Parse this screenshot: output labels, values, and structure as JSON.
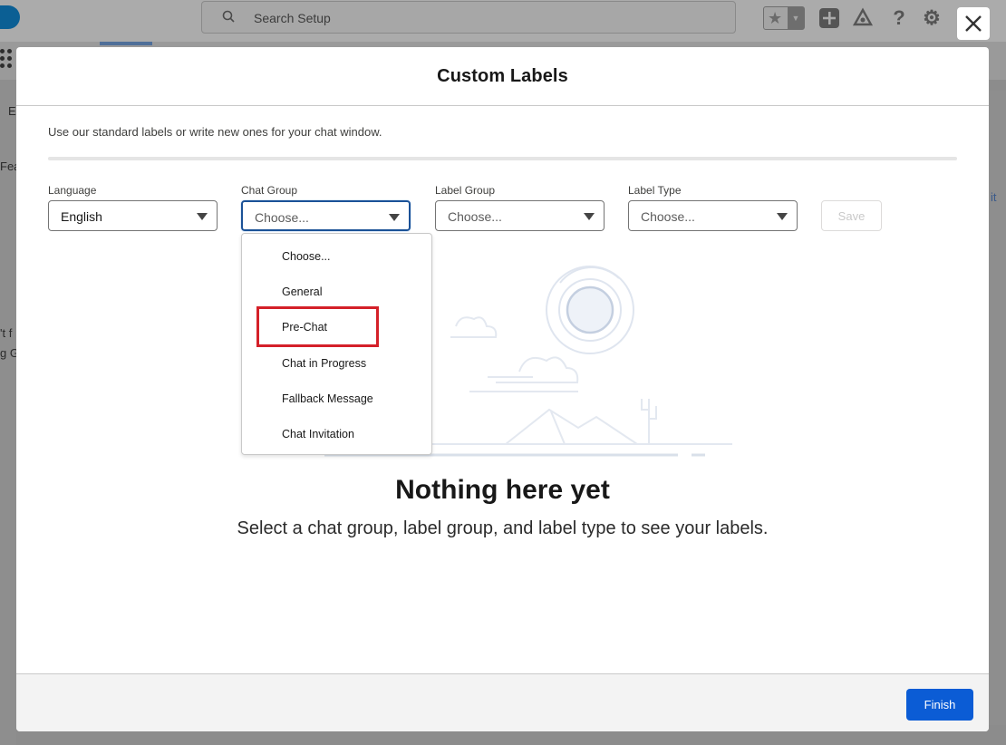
{
  "background": {
    "search_placeholder": "Search Setup",
    "left_texts": [
      "E",
      "Fea",
      "'t f",
      "g G"
    ],
    "right_texts": [
      "it"
    ],
    "icons": [
      "salesforce-cloud-icon",
      "search-icon",
      "star-icon",
      "add-icon",
      "trailhead-icon",
      "help-icon",
      "gear-icon",
      "app-launcher-icon"
    ]
  },
  "modal": {
    "title": "Custom Labels",
    "intro": "Use our standard labels or write new ones for your chat window.",
    "fields": {
      "language": {
        "label": "Language",
        "value": "English"
      },
      "chat_group": {
        "label": "Chat Group",
        "value": "Choose..."
      },
      "label_group": {
        "label": "Label Group",
        "value": "Choose..."
      },
      "label_type": {
        "label": "Label Type",
        "value": "Choose..."
      }
    },
    "save_label": "Save",
    "dropdown_options": [
      "Choose...",
      "General",
      "Pre-Chat",
      "Chat in Progress",
      "Fallback Message",
      "Chat Invitation"
    ],
    "highlighted_option": "Pre-Chat",
    "empty_title": "Nothing here yet",
    "empty_subtitle": "Select a chat group, label group, and label type to see your labels.",
    "finish_label": "Finish"
  },
  "colors": {
    "brand_button": "#0b5cd5",
    "focus_border": "#1b5297",
    "highlight_box": "#d42029"
  }
}
